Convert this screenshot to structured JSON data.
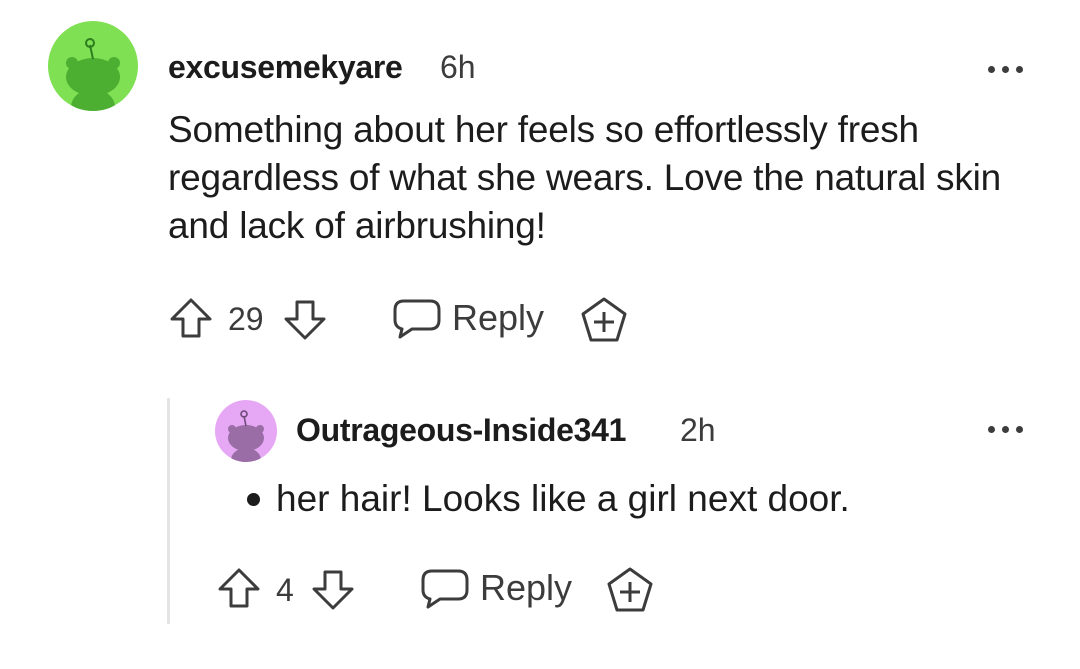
{
  "comments": [
    {
      "username": "excusemekyare",
      "time": "6h",
      "text": "Something about her feels so effortlessly fresh regardless of what she wears. Love the natural skin and lack of airbrushing!",
      "votes": "29",
      "reply_label": "Reply",
      "avatar_color": "#7ee052"
    },
    {
      "username": "Outrageous-Inside341",
      "time": "2h",
      "text": "her hair! Looks like a girl next door.",
      "votes": "4",
      "reply_label": "Reply",
      "avatar_color": "#e6a8f5"
    }
  ],
  "icons": {
    "upvote": "upvote-arrow-icon",
    "downvote": "downvote-arrow-icon",
    "reply": "speech-bubble-icon",
    "award": "award-plus-icon",
    "more": "more-options-icon"
  }
}
